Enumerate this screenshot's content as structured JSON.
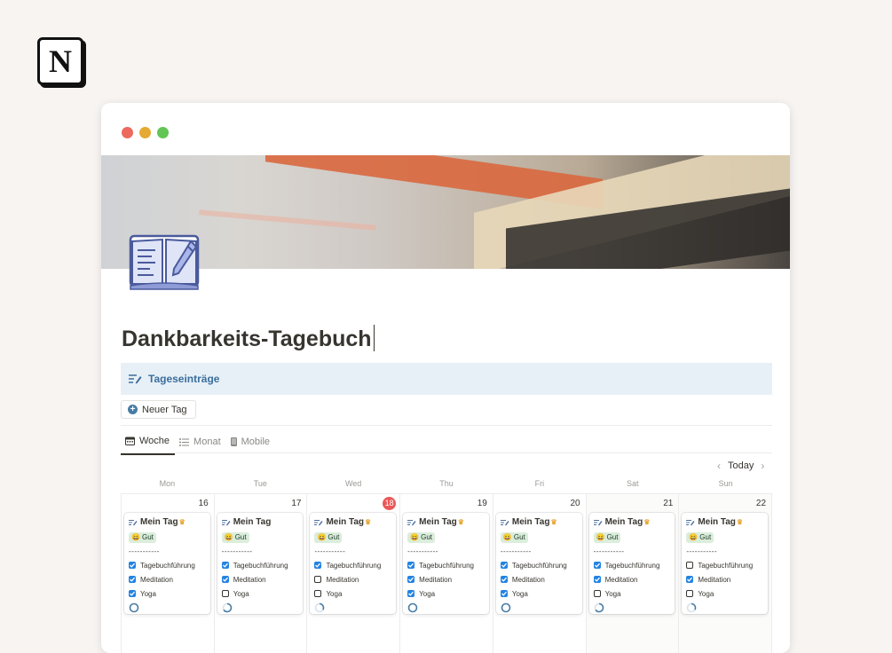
{
  "app": {
    "logo_letter": "N"
  },
  "window": {
    "dots": [
      "#ed6a5e",
      "#e5aa33",
      "#62c554"
    ]
  },
  "page": {
    "title": "Dankbarkeits-Tagebuch"
  },
  "database": {
    "name": "Tageseinträge",
    "new_button": "Neuer Tag",
    "views": [
      {
        "label": "Woche",
        "icon": "calendar-icon",
        "active": true
      },
      {
        "label": "Monat",
        "icon": "list-icon",
        "active": false
      },
      {
        "label": "Mobile",
        "icon": "phone-icon",
        "active": false
      }
    ],
    "today_label": "Today"
  },
  "calendar": {
    "weekdays": [
      "Mon",
      "Tue",
      "Wed",
      "Thu",
      "Fri",
      "Sat",
      "Sun"
    ],
    "days": [
      {
        "num": "16",
        "today": false,
        "title": "Mein Tag",
        "crown": true,
        "mood": "Gut",
        "dashes": "-----------",
        "checks": [
          true,
          true,
          true
        ],
        "progress": 0.0
      },
      {
        "num": "17",
        "today": false,
        "title": "Mein Tag",
        "crown": false,
        "mood": "Gut",
        "dashes": "-----------",
        "checks": [
          true,
          true,
          false
        ],
        "progress": 0.66
      },
      {
        "num": "18",
        "today": true,
        "title": "Mein Tag",
        "crown": true,
        "mood": "Gut",
        "dashes": "-----------",
        "checks": [
          true,
          false,
          false
        ],
        "progress": 0.33
      },
      {
        "num": "19",
        "today": false,
        "title": "Mein Tag",
        "crown": true,
        "mood": "Gut",
        "dashes": "-----------",
        "checks": [
          true,
          true,
          true
        ],
        "progress": 0.0
      },
      {
        "num": "20",
        "today": false,
        "title": "Mein Tag",
        "crown": true,
        "mood": "Gut",
        "dashes": "-----------",
        "checks": [
          true,
          true,
          true
        ],
        "progress": 0.0
      },
      {
        "num": "21",
        "today": false,
        "title": "Mein Tag",
        "crown": true,
        "mood": "Gut",
        "dashes": "-----------",
        "checks": [
          true,
          true,
          false
        ],
        "progress": 0.66
      },
      {
        "num": "22",
        "today": false,
        "title": "Mein Tag",
        "crown": true,
        "mood": "Gut",
        "dashes": "-----------",
        "checks": [
          false,
          true,
          false
        ],
        "progress": 0.33
      }
    ],
    "check_labels": [
      "Tagebuchführung",
      "Meditation",
      "Yoga"
    ],
    "colors": {
      "check_on": "#2383e2",
      "mood_bg": "#dbeddb",
      "today_badge": "#eb5757",
      "progress": "#487ca5"
    }
  }
}
